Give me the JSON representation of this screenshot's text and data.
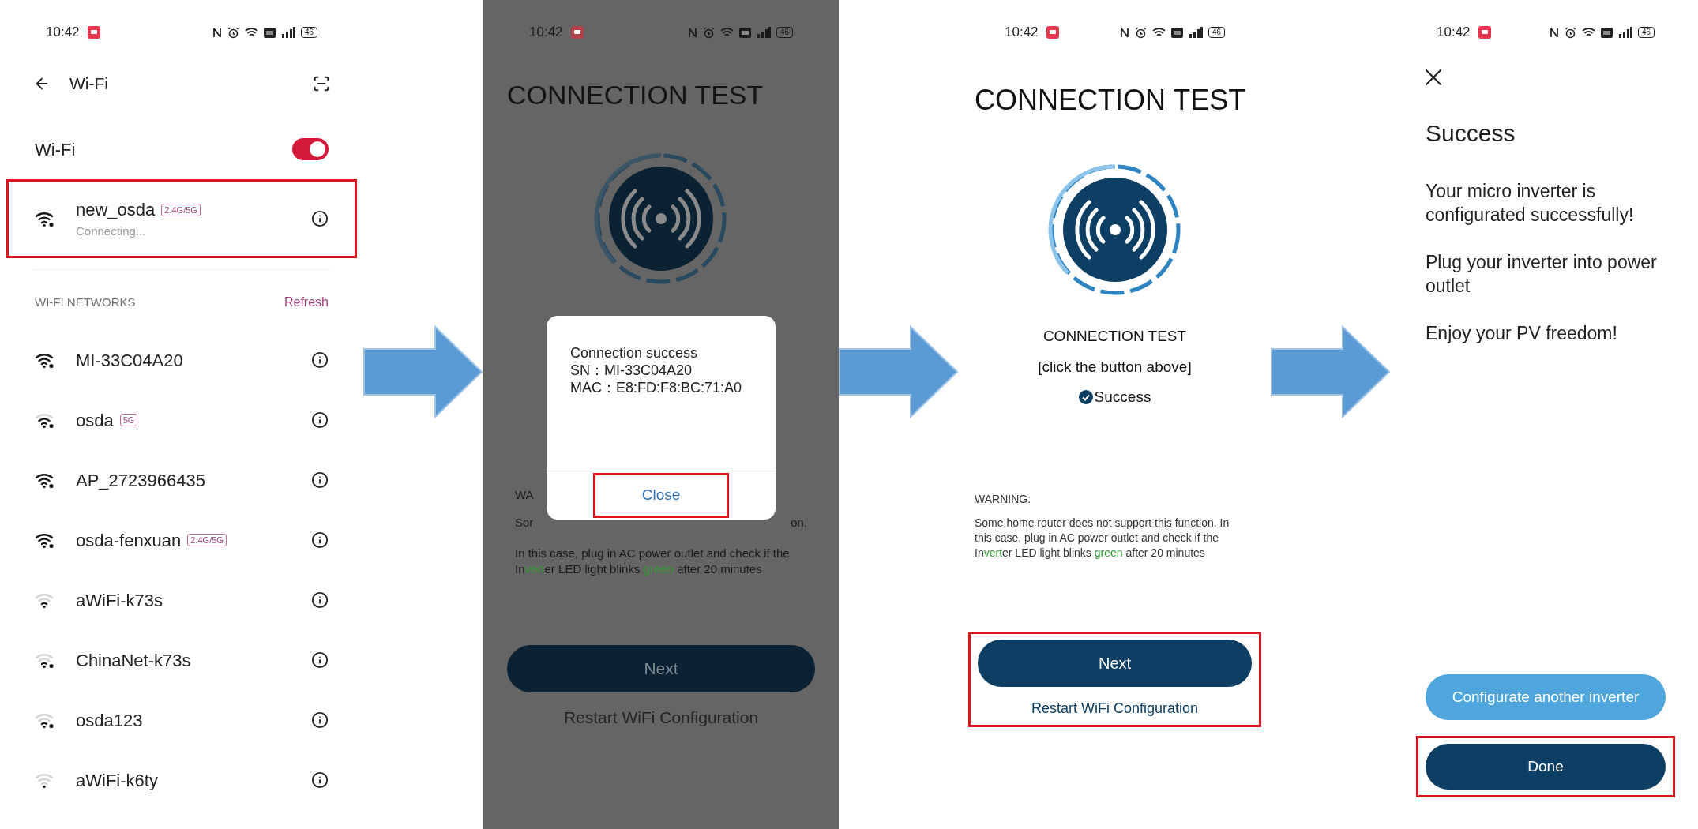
{
  "wifi_screen": {
    "status_bar": {
      "time": "10:42",
      "battery": "46"
    },
    "title": "Wi-Fi",
    "wifi_toggle": {
      "label": "Wi-Fi",
      "on": true
    },
    "current_network": {
      "name": "new_osda",
      "badge": "2.4G/5G",
      "status": "Connecting...",
      "kind": "strong",
      "secured": true,
      "highlighted": true
    },
    "section_title": "WI-FI NETWORKS",
    "refresh": "Refresh",
    "networks": [
      {
        "name": "MI-33C04A20",
        "kind": "strong",
        "secured": true
      },
      {
        "name": "osda",
        "badge": "5G",
        "kind": "medium",
        "secured": true
      },
      {
        "name": "AP_2723966435",
        "kind": "strong",
        "secured": true
      },
      {
        "name": "osda-fenxuan",
        "badge": "2.4G/5G",
        "kind": "strong",
        "secured": true
      },
      {
        "name": "aWiFi-k73s",
        "kind": "weak",
        "secured": false
      },
      {
        "name": "ChinaNet-k73s",
        "kind": "weak",
        "secured": true
      },
      {
        "name": "osda123",
        "kind": "weak",
        "secured": true
      },
      {
        "name": "aWiFi-k6ty",
        "kind": "minimal",
        "secured": false
      }
    ]
  },
  "dialog_screen": {
    "status_bar": {
      "time": "10:42",
      "battery": "46"
    },
    "title": "CONNECTION TEST",
    "warning_visible": {
      "label": "WA",
      "line_start": "Sor",
      "line_end": "on.",
      "rest": [
        {
          "text": "In this case, plug in AC power outlet and check if the In",
          "green": false
        },
        {
          "text": "vert",
          "green": true
        },
        {
          "text": "er LED light blinks ",
          "green": false
        },
        {
          "text": "green",
          "green": true
        },
        {
          "text": " after 20 minutes",
          "green": false
        }
      ]
    },
    "dialog": {
      "lines": [
        "Connection success",
        "SN：MI-33C04A20",
        "MAC：E8:FD:F8:BC:71:A0"
      ],
      "close": {
        "label": "Close",
        "highlighted": true
      }
    },
    "next_button": "Next",
    "restart_link": "Restart WiFi Configuration"
  },
  "test_screen": {
    "status_bar": {
      "time": "10:42",
      "battery": "46"
    },
    "title": "CONNECTION TEST",
    "test_label": "CONNECTION TEST",
    "hint": "[click the button above]",
    "result": {
      "label": "Success",
      "success": true
    },
    "warning": {
      "label": "WARNING:",
      "segments": [
        {
          "text": "Some home router does not support this function. In this case, plug in AC power outlet and check if the In",
          "green": false
        },
        {
          "text": "vert",
          "green": true
        },
        {
          "text": "er LED light blinks ",
          "green": false
        },
        {
          "text": "green",
          "green": true
        },
        {
          "text": " after 20 minutes",
          "green": false
        }
      ]
    },
    "actions": {
      "highlighted": true,
      "next": "Next",
      "restart": "Restart WiFi Configuration"
    }
  },
  "success_screen": {
    "status_bar": {
      "time": "10:42",
      "battery": "46"
    },
    "title": "Success",
    "paragraphs": [
      "Your micro inverter is configurated successfully!",
      "Plug your inverter into power outlet",
      "Enjoy your PV freedom!"
    ],
    "buttons": [
      {
        "label": "Configurate another inverter",
        "kind": "secondary"
      },
      {
        "label": "Done",
        "kind": "primary",
        "highlighted": true
      }
    ]
  }
}
